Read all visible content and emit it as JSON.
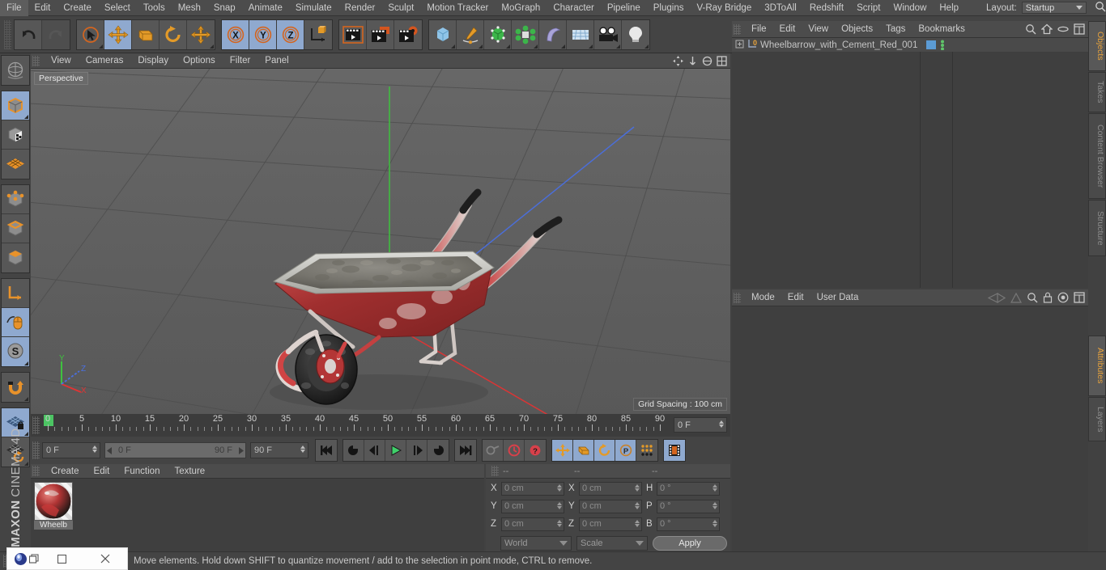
{
  "app": {
    "brand_bold": "MAXON",
    "brand_thin": "CINEMA 4D"
  },
  "menubar": {
    "items": [
      "File",
      "Edit",
      "Create",
      "Select",
      "Tools",
      "Mesh",
      "Snap",
      "Animate",
      "Simulate",
      "Render",
      "Sculpt",
      "Motion Tracker",
      "MoGraph",
      "Character",
      "Pipeline",
      "Plugins",
      "V-Ray Bridge",
      "3DToAll",
      "Redshift",
      "Script",
      "Window",
      "Help"
    ],
    "layout_label": "Layout:",
    "layout_value": "Startup"
  },
  "toolbar": {
    "groups": [
      {
        "name": "history",
        "buttons": [
          {
            "name": "undo-button",
            "icon": "undo",
            "state": "normal"
          },
          {
            "name": "redo-button",
            "icon": "redo",
            "state": "disabled"
          }
        ]
      },
      {
        "name": "tools",
        "buttons": [
          {
            "name": "live-selection-tool",
            "icon": "cursor-circle",
            "state": "normal"
          },
          {
            "name": "move-tool",
            "icon": "move-arrows",
            "state": "active"
          },
          {
            "name": "scale-tool",
            "icon": "scale-box",
            "state": "normal"
          },
          {
            "name": "rotate-tool",
            "icon": "rotate-arrow",
            "state": "normal"
          },
          {
            "name": "dynamic-place-tool",
            "icon": "move-arrows",
            "state": "normal"
          }
        ]
      },
      {
        "name": "axis-locks",
        "buttons": [
          {
            "name": "lock-x-axis",
            "icon": "x-circle",
            "state": "active"
          },
          {
            "name": "lock-y-axis",
            "icon": "y-circle",
            "state": "active"
          },
          {
            "name": "lock-z-axis",
            "icon": "z-circle",
            "state": "active"
          },
          {
            "name": "world-object-coord",
            "icon": "axis-cube",
            "state": "normal"
          }
        ]
      },
      {
        "name": "render",
        "buttons": [
          {
            "name": "render-view-button",
            "icon": "clapper",
            "state": "normal"
          },
          {
            "name": "render-region-button",
            "icon": "clapper-region",
            "state": "normal"
          },
          {
            "name": "render-settings-button",
            "icon": "clapper-gear",
            "state": "normal"
          }
        ]
      },
      {
        "name": "create",
        "buttons": [
          {
            "name": "add-cube-button",
            "icon": "cube-blue",
            "state": "normal"
          },
          {
            "name": "add-spline-button",
            "icon": "pen-spline",
            "state": "normal"
          },
          {
            "name": "add-nurbs-button",
            "icon": "green-cube",
            "state": "normal"
          },
          {
            "name": "add-array-button",
            "icon": "green-cluster",
            "state": "normal"
          },
          {
            "name": "add-bend-button",
            "icon": "purple-bend",
            "state": "normal"
          },
          {
            "name": "add-floor-button",
            "icon": "floor-grid",
            "state": "normal"
          },
          {
            "name": "add-camera-button",
            "icon": "camera",
            "state": "normal"
          },
          {
            "name": "add-light-button",
            "icon": "lightbulb",
            "state": "normal"
          }
        ]
      }
    ]
  },
  "left_toolbar": {
    "buttons": [
      {
        "name": "undo-view-button",
        "icon": "globe-wire",
        "state": "normal"
      },
      {
        "name": "model-mode-button",
        "icon": "cube-orange",
        "state": "active"
      },
      {
        "name": "texture-mode-button",
        "icon": "cube-checker",
        "state": "normal"
      },
      {
        "name": "workplane-mode-button",
        "icon": "grid-diamond",
        "state": "normal"
      },
      {
        "name": "point-mode-button",
        "icon": "cube-points",
        "state": "normal"
      },
      {
        "name": "edge-mode-button",
        "icon": "cube-edges",
        "state": "normal"
      },
      {
        "name": "polygon-mode-button",
        "icon": "cube-polygon",
        "state": "normal"
      },
      {
        "name": "axis-modify-button",
        "icon": "axis-L",
        "state": "normal"
      },
      {
        "name": "enable-axis-button",
        "icon": "mouse",
        "state": "active"
      },
      {
        "name": "soft-selection-button",
        "icon": "s-circle",
        "state": "active"
      },
      {
        "name": "snap-button",
        "icon": "magnet",
        "state": "normal"
      },
      {
        "name": "workplane-lock-button",
        "icon": "grid-lock",
        "state": "active"
      },
      {
        "name": "workplane-reset-button",
        "icon": "grid-reset",
        "state": "normal"
      }
    ]
  },
  "viewport": {
    "menu": [
      "View",
      "Cameras",
      "Display",
      "Options",
      "Filter",
      "Panel"
    ],
    "label": "Perspective",
    "grid_spacing": "Grid Spacing : 100 cm",
    "axis_gizmo": {
      "x": "X",
      "y": "Y",
      "z": "Z",
      "x_color": "#e03434",
      "y_color": "#3fc13f",
      "z_color": "#4a6fe0"
    }
  },
  "timeline": {
    "ruler_min": 0,
    "ruler_max": 90,
    "ruler_labels": [
      0,
      5,
      10,
      15,
      20,
      25,
      30,
      35,
      40,
      45,
      50,
      55,
      60,
      65,
      70,
      75,
      80,
      85,
      90
    ],
    "current_frame_field": "0 F",
    "start_frame": "0 F",
    "range_left": "0 F",
    "range_right": "90 F",
    "end_frame": "90 F",
    "transport": [
      {
        "name": "goto-start-button",
        "icon": "skip-start"
      },
      {
        "name": "play-backwards-button",
        "icon": "rewind-loop"
      },
      {
        "name": "step-back-button",
        "icon": "prev-frame"
      },
      {
        "name": "play-button",
        "icon": "play"
      },
      {
        "name": "step-forward-button",
        "icon": "next-frame"
      },
      {
        "name": "play-forward-loop-button",
        "icon": "forward-loop"
      },
      {
        "name": "goto-end-button",
        "icon": "skip-end"
      },
      {
        "name": "record-key-button",
        "icon": "key-disabled"
      },
      {
        "name": "autokeying-button",
        "icon": "red-circle"
      },
      {
        "name": "keyframe-selection-button",
        "icon": "red-question"
      },
      {
        "name": "position-key-button",
        "icon": "move-arrows"
      },
      {
        "name": "scale-key-button",
        "icon": "scale-box"
      },
      {
        "name": "rotation-key-button",
        "icon": "rotate-arrow"
      },
      {
        "name": "param-key-button",
        "icon": "p-circle"
      },
      {
        "name": "point-level-anim-button",
        "icon": "dots-grid"
      },
      {
        "name": "timeline-button",
        "icon": "film-strip"
      }
    ]
  },
  "material_manager": {
    "menu": [
      "Create",
      "Edit",
      "Function",
      "Texture"
    ],
    "materials": [
      {
        "name": "Wheelb"
      }
    ]
  },
  "coordinates": {
    "headers": [
      "--",
      "--",
      "--"
    ],
    "rows": [
      {
        "pos_axis": "X",
        "pos_value": "0 cm",
        "size_axis": "X",
        "size_value": "0 cm",
        "rot_axis": "H",
        "rot_value": "0 °"
      },
      {
        "pos_axis": "Y",
        "pos_value": "0 cm",
        "size_axis": "Y",
        "size_value": "0 cm",
        "rot_axis": "P",
        "rot_value": "0 °"
      },
      {
        "pos_axis": "Z",
        "pos_value": "0 cm",
        "size_axis": "Z",
        "size_value": "0 cm",
        "rot_axis": "B",
        "rot_value": "0 °"
      }
    ],
    "coord_system": "World",
    "transform_mode": "Scale",
    "apply_label": "Apply"
  },
  "object_manager": {
    "menu": [
      "File",
      "Edit",
      "View",
      "Objects",
      "Tags",
      "Bookmarks"
    ],
    "objects": [
      {
        "name": "Wheelbarrow_with_Cement_Red_001",
        "level_badge": "0"
      }
    ]
  },
  "attribute_manager": {
    "menu": [
      "Mode",
      "Edit",
      "User Data"
    ]
  },
  "right_tabs": [
    {
      "label": "Objects",
      "active": true
    },
    {
      "label": "Takes",
      "active": false
    },
    {
      "label": "Content Browser",
      "active": false
    },
    {
      "label": "Structure",
      "active": false
    },
    {
      "label": "Attributes",
      "active": true
    },
    {
      "label": "Layers",
      "active": false
    }
  ],
  "statusbar": {
    "text": "Move elements. Hold down SHIFT to quantize movement / add to the selection in point mode, CTRL to remove."
  },
  "colors": {
    "accent_orange": "#e8a33d",
    "panel_bg": "#444444",
    "field_bg": "#4b4b4b",
    "active_blue": "#8fa9cf",
    "green_marker": "#4cc463"
  }
}
